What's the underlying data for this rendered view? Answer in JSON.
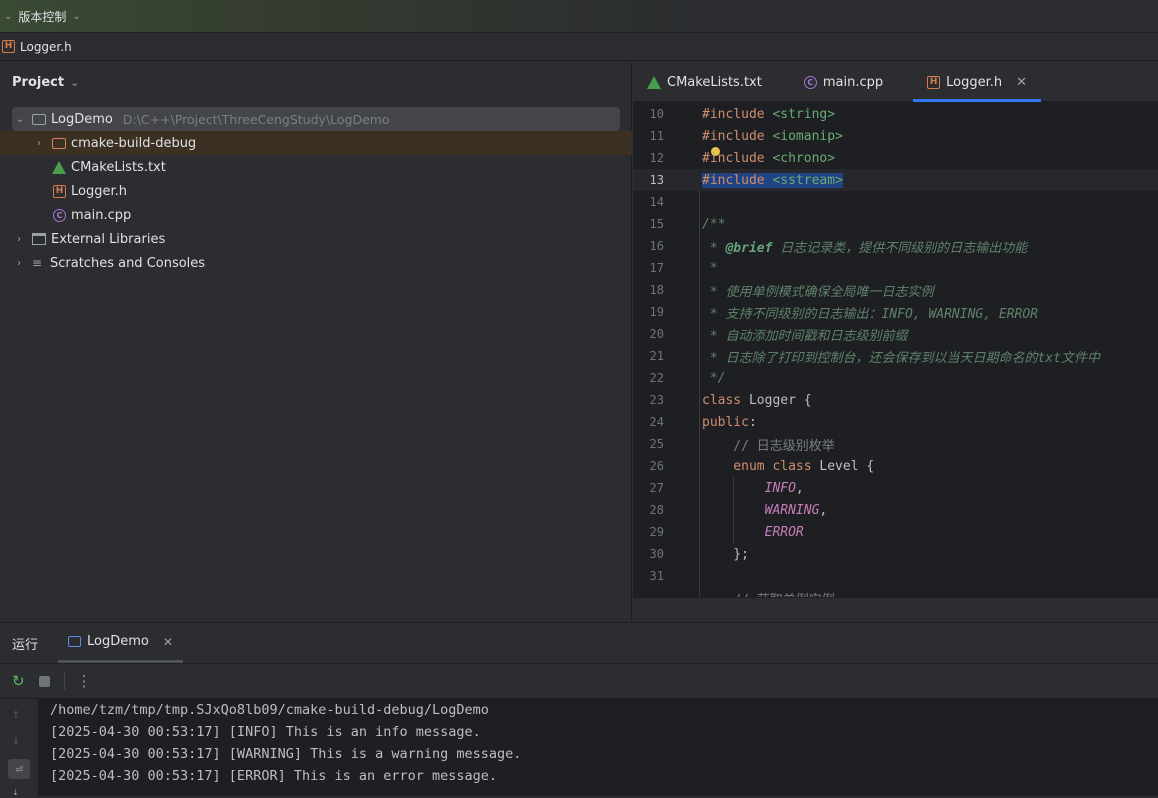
{
  "top_bar": {
    "vcs_label": "版本控制"
  },
  "breadcrumb": {
    "file": "Logger.h"
  },
  "project_panel": {
    "title": "Project",
    "items": [
      {
        "name": "LogDemo",
        "path": "D:\\C++\\Project\\ThreeCengStudy\\LogDemo"
      },
      {
        "name": "cmake-build-debug"
      },
      {
        "name": "CMakeLists.txt"
      },
      {
        "name": "Logger.h"
      },
      {
        "name": "main.cpp"
      },
      {
        "name": "External Libraries"
      },
      {
        "name": "Scratches and Consoles"
      }
    ]
  },
  "editor": {
    "tabs": [
      {
        "label": "CMakeLists.txt"
      },
      {
        "label": "main.cpp"
      },
      {
        "label": "Logger.h",
        "active": true
      }
    ],
    "line_numbers": [
      "10",
      "11",
      "12",
      "13",
      "14",
      "15",
      "16",
      "17",
      "18",
      "19",
      "20",
      "21",
      "22",
      "23",
      "24",
      "25",
      "26",
      "27",
      "28",
      "29",
      "30",
      "31"
    ],
    "code": {
      "l10_a": "#include ",
      "l10_b": "<string>",
      "l11_a": "#include ",
      "l11_b": "<iomanip>",
      "l12_a": "#include ",
      "l12_b": "<chrono>",
      "l13_a": "#include ",
      "l13_b": "<sstream>",
      "l15": "/**",
      "l16_a": " * ",
      "l16_b": "@brief",
      "l16_c": " 日志记录类，提供不同级别的日志输出功能",
      "l17": " *",
      "l18": " * 使用单例模式确保全局唯一日志实例",
      "l19": " * 支持不同级别的日志输出：INFO, WARNING, ERROR",
      "l20": " * 自动添加时间戳和日志级别前缀",
      "l21": " * 日志除了打印到控制台，还会保存到以当天日期命名的txt文件中",
      "l22": " */",
      "l23_a": "class ",
      "l23_b": "Logger {",
      "l24_a": "public",
      "l24_b": ":",
      "l25": "    // 日志级别枚举",
      "l26_a": "    enum class ",
      "l26_b": "Level {",
      "l27_a": "        INFO",
      "l27_b": ",",
      "l28_a": "        WARNING",
      "l28_b": ",",
      "l29_a": "        ERROR",
      "l30": "    };",
      "l32": "    // 获取单例实例"
    }
  },
  "run_panel": {
    "label": "运行",
    "tab": "LogDemo",
    "console_lines": [
      "/home/tzm/tmp/tmp.SJxQo8lb09/cmake-build-debug/LogDemo",
      "[2025-04-30 00:53:17] [INFO] This is an info message.",
      "[2025-04-30 00:53:17] [WARNING] This is a warning message.",
      "[2025-04-30 00:53:17] [ERROR] This is an error message."
    ]
  },
  "colors": {
    "accent": "#3574f0",
    "selection": "#214283",
    "background": "#1e1f22",
    "panel": "#2b2d30"
  }
}
